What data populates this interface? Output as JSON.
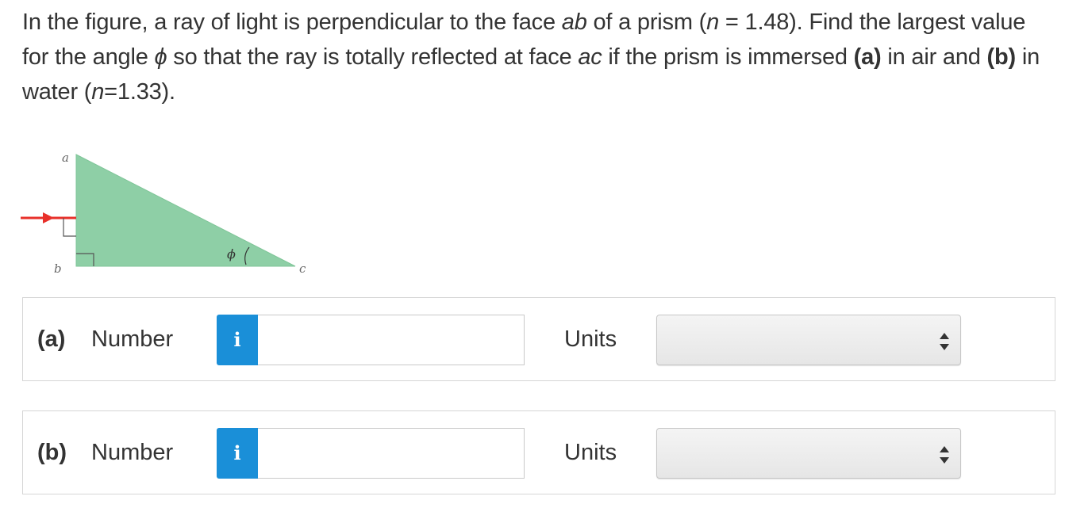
{
  "question": {
    "part1": "In the figure, a ray of light is perpendicular to the face ",
    "face_ab": "ab",
    "part2": " of a prism (",
    "n_symbol": "n",
    "part3": " = 1.48). Find the largest value for the angle ",
    "phi_symbol": "ϕ",
    "part4": " so that the ray is totally reflected at face ",
    "face_ac": "ac",
    "part5": " if the prism is immersed ",
    "a_marker": "(a)",
    "part6": " in air and ",
    "b_marker": "(b)",
    "part7": " in water (",
    "n_symbol2": "n",
    "part8": "=1.33)."
  },
  "figure": {
    "label_a": "a",
    "label_b": "b",
    "label_c": "c",
    "label_phi": "ϕ",
    "prism_color": "#8ecfa6",
    "ray_color": "#e8302a"
  },
  "answers": [
    {
      "part": "(a)",
      "number_label": "Number",
      "info_icon": "i",
      "number_value": "",
      "units_label": "Units",
      "units_value": ""
    },
    {
      "part": "(b)",
      "number_label": "Number",
      "info_icon": "i",
      "number_value": "",
      "units_label": "Units",
      "units_value": ""
    }
  ],
  "colors": {
    "info_button": "#1a8fd8",
    "text": "#333333",
    "border": "#d6d6d6"
  }
}
